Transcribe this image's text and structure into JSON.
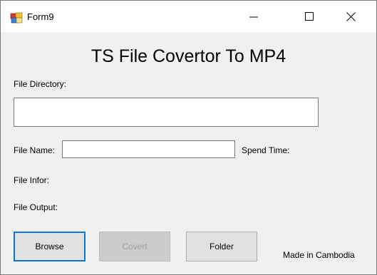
{
  "window": {
    "title": "Form9",
    "icon": "winforms-app-icon",
    "controls": {
      "minimize": "minimize-icon",
      "maximize": "maximize-icon",
      "close": "close-icon"
    }
  },
  "form": {
    "heading": "TS File Covertor To MP4",
    "file_directory_label": "File Directory:",
    "file_directory_value": "",
    "file_name_label": "File Name:",
    "file_name_value": "",
    "spend_time_label": "Spend Time:",
    "file_infor_label": "File Infor:",
    "file_output_label": "File Output:"
  },
  "buttons": {
    "browse": "Browse",
    "covert": "Covert",
    "folder": "Folder"
  },
  "footer": {
    "credit": "Made in Cambodia"
  },
  "colors": {
    "focus_border": "#0078d7",
    "form_background": "#f0f0f0",
    "disabled_text": "#a0a0a0"
  }
}
